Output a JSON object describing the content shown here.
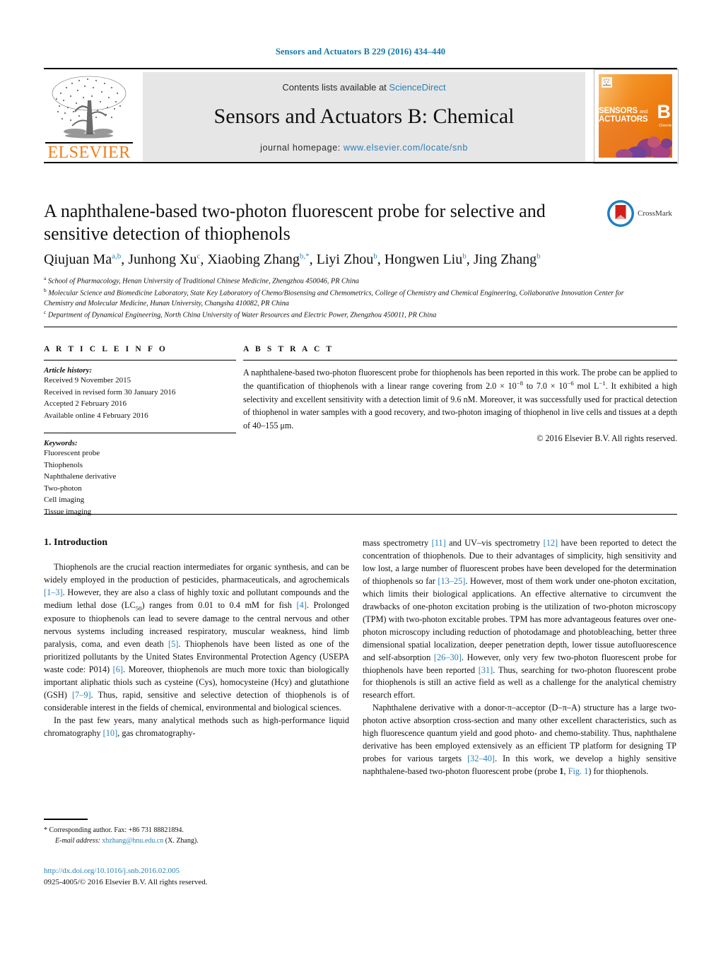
{
  "running_head": "Sensors and Actuators B 229 (2016) 434–440",
  "masthead": {
    "contents_prefix": "Contents lists available at ",
    "sciencedirect": "ScienceDirect",
    "journal_name": "Sensors and Actuators B: Chemical",
    "homepage_prefix": "journal homepage: ",
    "homepage_url": "www.elsevier.com/locate/snb",
    "publisher": "ELSEVIER",
    "cover": {
      "line1": "SENSORS",
      "and": "and",
      "line2": "ACTUATORS",
      "letter": "B",
      "sub": "Chemical"
    }
  },
  "article": {
    "title": "A naphthalene-based two-photon fluorescent probe for selective and sensitive detection of thiophenols",
    "crossmark_label": "CrossMark",
    "authors": [
      {
        "name": "Qiujuan Ma",
        "marks": "a,b",
        "sep": ", "
      },
      {
        "name": "Junhong Xu",
        "marks": "c",
        "sep": ", "
      },
      {
        "name": "Xiaobing Zhang",
        "marks": "b,",
        "star": "*",
        "sep": ", "
      },
      {
        "name": "Liyi Zhou",
        "marks": "b",
        "sep": ", "
      },
      {
        "name": "Hongwen Liu",
        "marks": "b",
        "sep": ", "
      },
      {
        "name": "Jing Zhang",
        "marks": "b",
        "sep": ""
      }
    ],
    "affiliations": [
      {
        "mark": "a",
        "text": "School of Pharmacology, Henan University of Traditional Chinese Medicine, Zhengzhou 450046, PR China"
      },
      {
        "mark": "b",
        "text": "Molecular Science and Biomedicine Laboratory, State Key Laboratory of Chemo/Biosensing and Chemometrics, College of Chemistry and Chemical Engineering, Collaborative Innovation Center for Chemistry and Molecular Medicine, Hunan University, Changsha 410082, PR China"
      },
      {
        "mark": "c",
        "text": "Department of Dynamical Engineering, North China University of Water Resources and Electric Power, Zhengzhou 450011, PR China"
      }
    ]
  },
  "article_info": {
    "heading": "A R T I C L E    I N F O",
    "history_title": "Article history:",
    "history": [
      "Received 9 November 2015",
      "Received in revised form 30 January 2016",
      "Accepted 2 February 2016",
      "Available online 4 February 2016"
    ],
    "keywords_title": "Keywords:",
    "keywords": [
      "Fluorescent probe",
      "Thiophenols",
      "Naphthalene derivative",
      "Two-photon",
      "Cell imaging",
      "Tissue imaging"
    ]
  },
  "abstract": {
    "heading": "A B S T R A C T",
    "text_html": "A naphthalene-based two-photon fluorescent probe for thiophenols has been reported in this work. The probe can be applied to the quantification of thiophenols with a linear range covering from 2.0 × 10<sup class=\"small\">−8</sup> to 7.0 × 10<sup class=\"small\">−6</sup> mol L<sup class=\"small\">−1</sup>. It exhibited a high selectivity and excellent sensitivity with a detection limit of 9.6 nM. Moreover, it was successfully used for practical detection of thiophenol in water samples with a good recovery, and two-photon imaging of thiophenol in live cells and tissues at a depth of 40–155 μm.",
    "copyright": "© 2016 Elsevier B.V. All rights reserved."
  },
  "body": {
    "section_heading": "1.  Introduction",
    "left_paragraphs_html": [
      "Thiophenols are the crucial reaction intermediates for organic synthesis, and can be widely employed in the production of pesticides, pharmaceuticals, and agrochemicals <span class=\"ref\">[1–3]</span>. However, they are also a class of highly toxic and pollutant compounds and the medium lethal dose (LC<sub class=\"small\">50</sub>) ranges from 0.01 to 0.4 mM for fish <span class=\"ref\">[4]</span>. Prolonged exposure to thiophenols can lead to severe damage to the central nervous and other nervous systems including increased respiratory, muscular weakness, hind limb paralysis, coma, and even death <span class=\"ref\">[5]</span>. Thiophenols have been listed as one of the prioritized pollutants by the United States Environmental Protection Agency (USEPA waste code: P014) <span class=\"ref\">[6]</span>. Moreover, thiophenols are much more toxic than biologically important aliphatic thiols such as cysteine (Cys), homocysteine (Hcy) and glutathione (GSH) <span class=\"ref\">[7–9]</span>. Thus, rapid, sensitive and selective detection of thiophenols is of considerable interest in the fields of chemical, environmental and biological sciences.",
      "In the past few years, many analytical methods such as high-performance liquid chromatography <span class=\"ref\">[10]</span>, gas chromatography-"
    ],
    "right_paragraphs_html": [
      "mass spectrometry <span class=\"ref\">[11]</span> and UV–vis spectrometry <span class=\"ref\">[12]</span> have been reported to detect the concentration of thiophenols. Due to their advantages of simplicity, high sensitivity and low lost, a large number of fluorescent probes have been developed for the determination of thiophenols so far <span class=\"ref\">[13–25]</span>. However, most of them work under one-photon excitation, which limits their biological applications. An effective alternative to circumvent the drawbacks of one-photon excitation probing is the utilization of two-photon microscopy (TPM) with two-photon excitable probes. TPM has more advantageous features over one-photon microscopy including reduction of photodamage and photobleaching, better three dimensional spatial localization, deeper penetration depth, lower tissue autofluorescence and self-absorption <span class=\"ref\">[26–30]</span>. However, only very few two-photon fluorescent probe for thiophenols have been reported <span class=\"ref\">[31]</span>. Thus, searching for two-photon fluorescent probe for thiophenols is still an active field as well as a challenge for the analytical chemistry research effort.",
      "Naphthalene derivative with a donor-π–acceptor (D–π–A) structure has a large two-photon active absorption cross-section and many other excellent characteristics, such as high fluorescence quantum yield and good photo- and chemo-stability. Thus, naphthalene derivative has been employed extensively as an efficient TP platform for designing TP probes for various targets <span class=\"ref\">[32–40]</span>. In this work, we develop a highly sensitive naphthalene-based two-photon fluorescent probe (probe <b>1</b>, <span class=\"figlink\">Fig. 1</span>) for thiophenols."
    ]
  },
  "footnote": {
    "corresponding_marker": "*",
    "corresponding_text": "Corresponding author. Fax: +86 731 88821894.",
    "email_label": "E-mail address:",
    "email": "xbzhang@hnu.edu.cn",
    "email_suffix": " (X. Zhang).",
    "doi": "http://dx.doi.org/10.1016/j.snb.2016.02.005",
    "issn_line": "0925-4005/© 2016 Elsevier B.V. All rights reserved."
  },
  "colors": {
    "link": "#2a7fb5",
    "runhead": "#1277a8",
    "elsevier_orange": "#f07f18",
    "band": "#e6e6e6"
  }
}
